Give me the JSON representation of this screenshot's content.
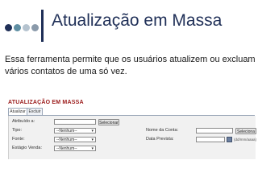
{
  "slide": {
    "title": "Atualização em Massa",
    "description": "Essa ferramenta permite que os usuários atualizem ou excluam vários contatos de uma só vez.",
    "bullet_colors": [
      "#1f2f57",
      "#5f8fa3",
      "#b5c3cf",
      "#8a9aaa"
    ]
  },
  "screenshot": {
    "heading": "ATUALIZAÇÃO EM MASSA",
    "tabs": [
      "Atualizar",
      "Excluir"
    ],
    "fields": {
      "assigned_to": {
        "label": "Atribuído a:",
        "value": "",
        "button": "Selecionar"
      },
      "type": {
        "label": "Tipo:",
        "value": "--Nenhum--"
      },
      "source": {
        "label": "Fonte:",
        "value": "--Nenhum--"
      },
      "sales_stage": {
        "label": "Estágio Venda:",
        "value": "--Nenhum--"
      },
      "account_name": {
        "label": "Nome da Conta:",
        "value": "",
        "button": "Seleciona"
      },
      "expected_date": {
        "label": "Data Prevista:",
        "value": "",
        "hint": "(dd/mm/aaaa)"
      }
    },
    "icons": {
      "calendar": "calendar-icon",
      "dropdown": "chevron-down-icon"
    }
  }
}
